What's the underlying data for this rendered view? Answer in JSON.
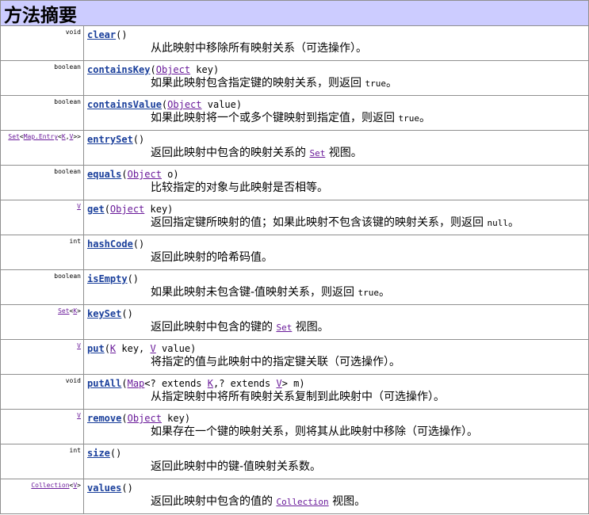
{
  "header": {
    "title": "方法摘要"
  },
  "methods": [
    {
      "return_type": "void",
      "name": "clear",
      "sig_rest": "()",
      "summary": "从此映射中移除所有映射关系（可选操作）。"
    },
    {
      "return_type": "boolean",
      "name": "containsKey",
      "param_type": "Object",
      "param_rest": " key)",
      "summary": "如果此映射包含指定键的映射关系，则返回 ",
      "summary_code": "true",
      "summary_end": "。"
    },
    {
      "return_type": "boolean",
      "name": "containsValue",
      "param_type": "Object",
      "param_rest": " value)",
      "summary": "如果此映射将一个或多个键映射到指定值，则返回 ",
      "summary_code": "true",
      "summary_end": "。"
    },
    {
      "return_type_parts": [
        "Set",
        "<",
        "Map.Entry",
        "<",
        "K",
        ",",
        "V",
        ">>"
      ],
      "name": "entrySet",
      "sig_rest": "()",
      "summary": "返回此映射中包含的映射关系的 ",
      "summary_link": "Set",
      "summary_end": " 视图。"
    },
    {
      "return_type": "boolean",
      "name": "equals",
      "param_type": "Object",
      "param_rest": " o)",
      "summary": "比较指定的对象与此映射是否相等。"
    },
    {
      "return_type": "V",
      "name": "get",
      "param_type": "Object",
      "param_rest": " key)",
      "summary": "返回指定键所映射的值；如果此映射不包含该键的映射关系，则返回 ",
      "summary_code": "null",
      "summary_end": "。"
    },
    {
      "return_type": "int",
      "name": "hashCode",
      "sig_rest": "()",
      "summary": "返回此映射的哈希码值。"
    },
    {
      "return_type": "boolean",
      "name": "isEmpty",
      "sig_rest": "()",
      "summary": "如果此映射未包含键-值映射关系，则返回 ",
      "summary_code": "true",
      "summary_end": "。"
    },
    {
      "return_type_parts": [
        "Set",
        "<",
        "K",
        ">"
      ],
      "name": "keySet",
      "sig_rest": "()",
      "summary": "返回此映射中包含的键的 ",
      "summary_link": "Set",
      "summary_end": " 视图。"
    },
    {
      "return_type": "V",
      "name": "put",
      "summary": "将指定的值与此映射中的指定键关联（可选操作）。"
    },
    {
      "return_type": "void",
      "name": "putAll",
      "summary": "从指定映射中将所有映射关系复制到此映射中（可选操作）。"
    },
    {
      "return_type": "V",
      "name": "remove",
      "param_type": "Object",
      "param_rest": " key)",
      "summary": "如果存在一个键的映射关系，则将其从此映射中移除（可选操作）。"
    },
    {
      "return_type": "int",
      "name": "size",
      "sig_rest": "()",
      "summary": "返回此映射中的键-值映射关系数。"
    },
    {
      "return_type_parts": [
        "Collection",
        "<",
        "V",
        ">"
      ],
      "name": "values",
      "sig_rest": "()",
      "summary": "返回此映射中包含的值的 ",
      "summary_link": "Collection",
      "summary_end": " 视图。"
    }
  ],
  "put_sig": {
    "open": "(",
    "k": "K",
    "k_rest": " key, ",
    "v": "V",
    "v_rest": " value)"
  },
  "putAll_sig": {
    "open": "(",
    "map": "Map",
    "lt": "<? extends ",
    "k": "K",
    "mid": ",? extends ",
    "v": "V",
    "end": "> m)"
  },
  "colors": {
    "header_bg": "#ccccff",
    "method_link": "#1a3f9b",
    "type_link": "#6a1b9a",
    "border": "#8f8f8f"
  }
}
